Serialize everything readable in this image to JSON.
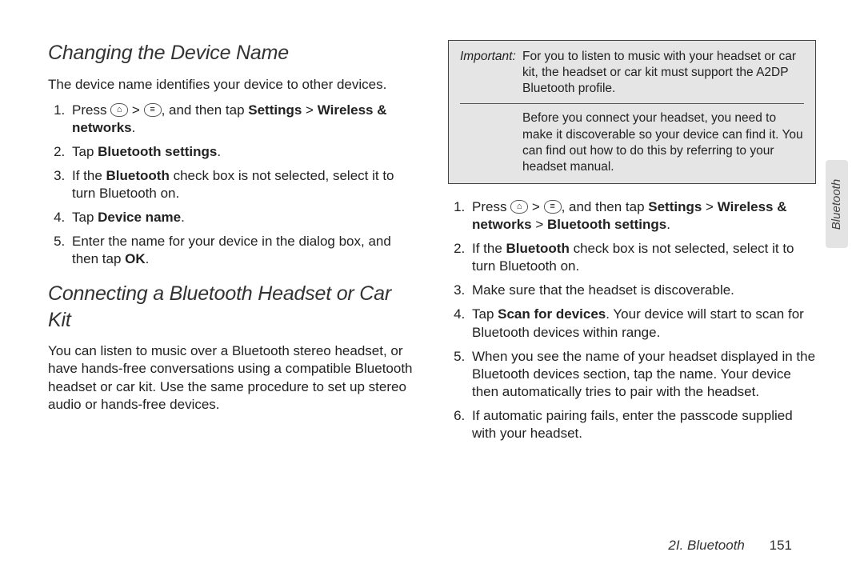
{
  "left": {
    "h1": "Changing the Device Name",
    "p1": "The device name identifies your device to other devices.",
    "l1a": "Press ",
    "l1b": " > ",
    "l1c": ", and then tap ",
    "l1_settings": "Settings",
    "l1_gt": " > ",
    "l1_wireless": "Wireless & networks",
    "l1_dot": ".",
    "l2a": "Tap ",
    "l2b": "Bluetooth settings",
    "l2c": ".",
    "l3a": "If the ",
    "l3b": "Bluetooth",
    "l3c": " check box is not selected, select it to turn Bluetooth on.",
    "l4a": "Tap ",
    "l4b": "Device name",
    "l4c": ".",
    "l5a": "Enter the name for your device in the dialog box, and then tap ",
    "l5b": "OK",
    "l5c": ".",
    "h2": "Connecting a Bluetooth Headset or Car Kit",
    "p2": "You can listen to music over a Bluetooth stereo headset, or have hands-free conversations using a compatible Bluetooth headset or car kit. Use the same procedure to set up stereo audio or hands-free devices."
  },
  "right": {
    "box_label": "Important:",
    "box_text1": "For you to listen to music with your headset or car kit, the headset or car kit must support the A2DP Bluetooth profile.",
    "box_text2": "Before you connect your headset, you need to make it discoverable so your device can find it. You can find out how to do this by referring to your headset manual.",
    "r1a": "Press ",
    "r1b": " > ",
    "r1c": ", and then tap ",
    "r1_settings": "Settings",
    "r1_gt1": " > ",
    "r1_wireless": "Wireless & networks",
    "r1_gt2": " > ",
    "r1_bt": "Bluetooth settings",
    "r1_dot": ".",
    "r2a": "If the ",
    "r2b": "Bluetooth",
    "r2c": " check box is not selected, select it to turn Bluetooth on.",
    "r3": "Make sure that the headset is discoverable.",
    "r4a": "Tap ",
    "r4b": "Scan for devices",
    "r4c": ". Your device will start to scan for Bluetooth devices within range.",
    "r5": "When you see the name of your headset displayed in the Bluetooth devices section, tap the name. Your device then automatically tries to pair with the headset.",
    "r6": "If automatic pairing fails, enter the passcode supplied with your headset."
  },
  "tab": "Bluetooth",
  "footer_section": "2I. Bluetooth",
  "footer_page": "151"
}
